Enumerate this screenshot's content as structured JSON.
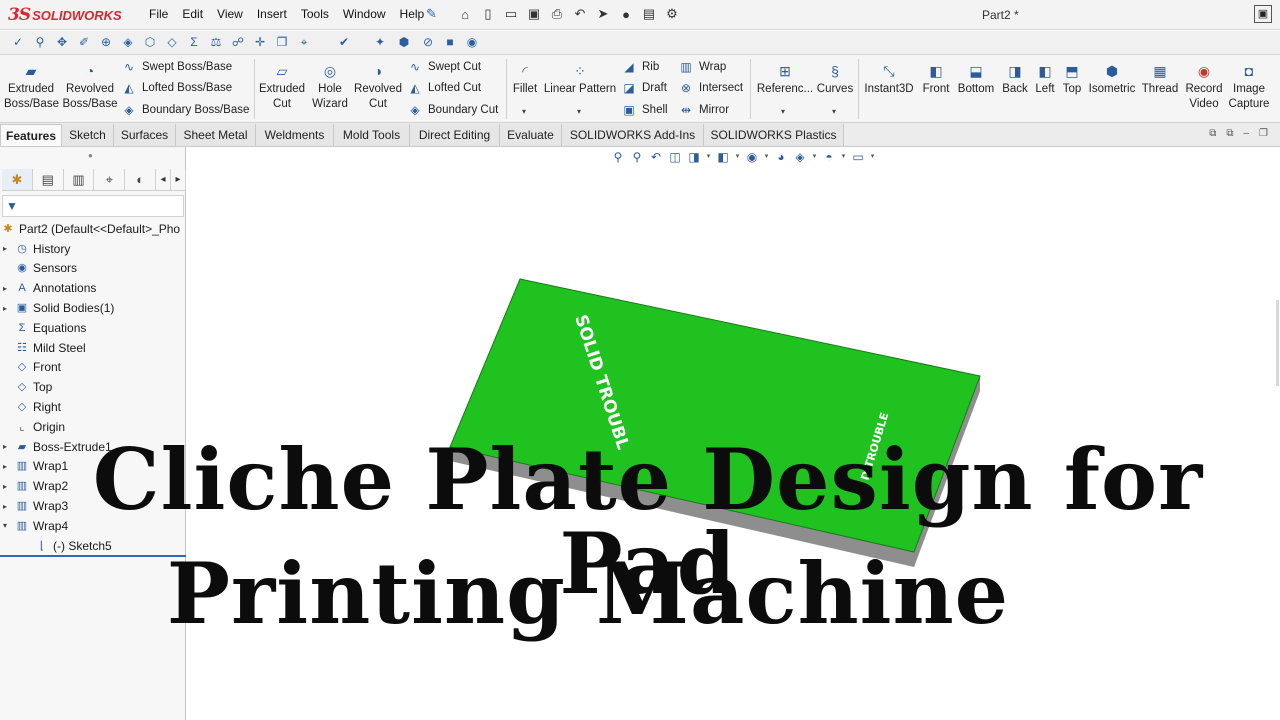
{
  "app": {
    "brand": "SOLIDWORKS",
    "document_title": "Part2 *",
    "menu": [
      "File",
      "Edit",
      "View",
      "Insert",
      "Tools",
      "Window",
      "Help"
    ]
  },
  "command_manager": {
    "extruded_boss": "Extruded\nBoss/Base",
    "revolved_boss": "Revolved\nBoss/Base",
    "swept_boss": "Swept Boss/Base",
    "lofted_boss": "Lofted Boss/Base",
    "boundary_boss": "Boundary Boss/Base",
    "extruded_cut": "Extruded\nCut",
    "hole_wizard": "Hole\nWizard",
    "revolved_cut": "Revolved\nCut",
    "swept_cut": "Swept Cut",
    "lofted_cut": "Lofted Cut",
    "boundary_cut": "Boundary Cut",
    "fillet": "Fillet",
    "linear_pattern": "Linear Pattern",
    "rib": "Rib",
    "draft": "Draft",
    "shell": "Shell",
    "wrap": "Wrap",
    "intersect": "Intersect",
    "mirror": "Mirror",
    "reference": "Referenc...",
    "curves": "Curves",
    "instant3d": "Instant3D",
    "front": "Front",
    "bottom": "Bottom",
    "back": "Back",
    "left": "Left",
    "top": "Top",
    "isometric": "Isometric",
    "thread": "Thread",
    "record_video": "Record\nVideo",
    "image_capture": "Image\nCapture"
  },
  "tabs": [
    "Features",
    "Sketch",
    "Surfaces",
    "Sheet Metal",
    "Weldments",
    "Mold Tools",
    "Direct Editing",
    "Evaluate",
    "SOLIDWORKS Add-Ins",
    "SOLIDWORKS Plastics"
  ],
  "tree": {
    "root": "Part2  (Default<<Default>_Pho",
    "items": [
      {
        "label": "History",
        "icon": "history-icon",
        "expandable": true
      },
      {
        "label": "Sensors",
        "icon": "sensors-icon",
        "expandable": false
      },
      {
        "label": "Annotations",
        "icon": "annotations-icon",
        "expandable": true
      },
      {
        "label": "Solid Bodies(1)",
        "icon": "solid-bodies-icon",
        "expandable": true
      },
      {
        "label": "Equations",
        "icon": "equations-icon",
        "expandable": false
      },
      {
        "label": "Mild Steel",
        "icon": "material-icon",
        "expandable": false
      },
      {
        "label": "Front",
        "icon": "plane-icon",
        "expandable": false
      },
      {
        "label": "Top",
        "icon": "plane-icon",
        "expandable": false
      },
      {
        "label": "Right",
        "icon": "plane-icon",
        "expandable": false
      },
      {
        "label": "Origin",
        "icon": "origin-icon",
        "expandable": false
      },
      {
        "label": "Boss-Extrude1",
        "icon": "extrude-feature-icon",
        "expandable": true
      },
      {
        "label": "Wrap1",
        "icon": "wrap-feature-icon",
        "expandable": true
      },
      {
        "label": "Wrap2",
        "icon": "wrap-feature-icon",
        "expandable": true
      },
      {
        "label": "Wrap3",
        "icon": "wrap-feature-icon",
        "expandable": true
      },
      {
        "label": "Wrap4",
        "icon": "wrap-feature-icon",
        "expandable": true,
        "expanded": true
      },
      {
        "label": "(-) Sketch5",
        "icon": "sketch-icon",
        "expandable": false,
        "child": true
      }
    ]
  },
  "model": {
    "plate_color": "#1fc21f",
    "edge_color": "#8e8e8e",
    "engraving_1": "SOLID TROUBL",
    "engraving_2": "D TROUBLE"
  },
  "overlay": {
    "line1": "Cliche Plate Design for Pad",
    "line2": "Printing Machine"
  }
}
